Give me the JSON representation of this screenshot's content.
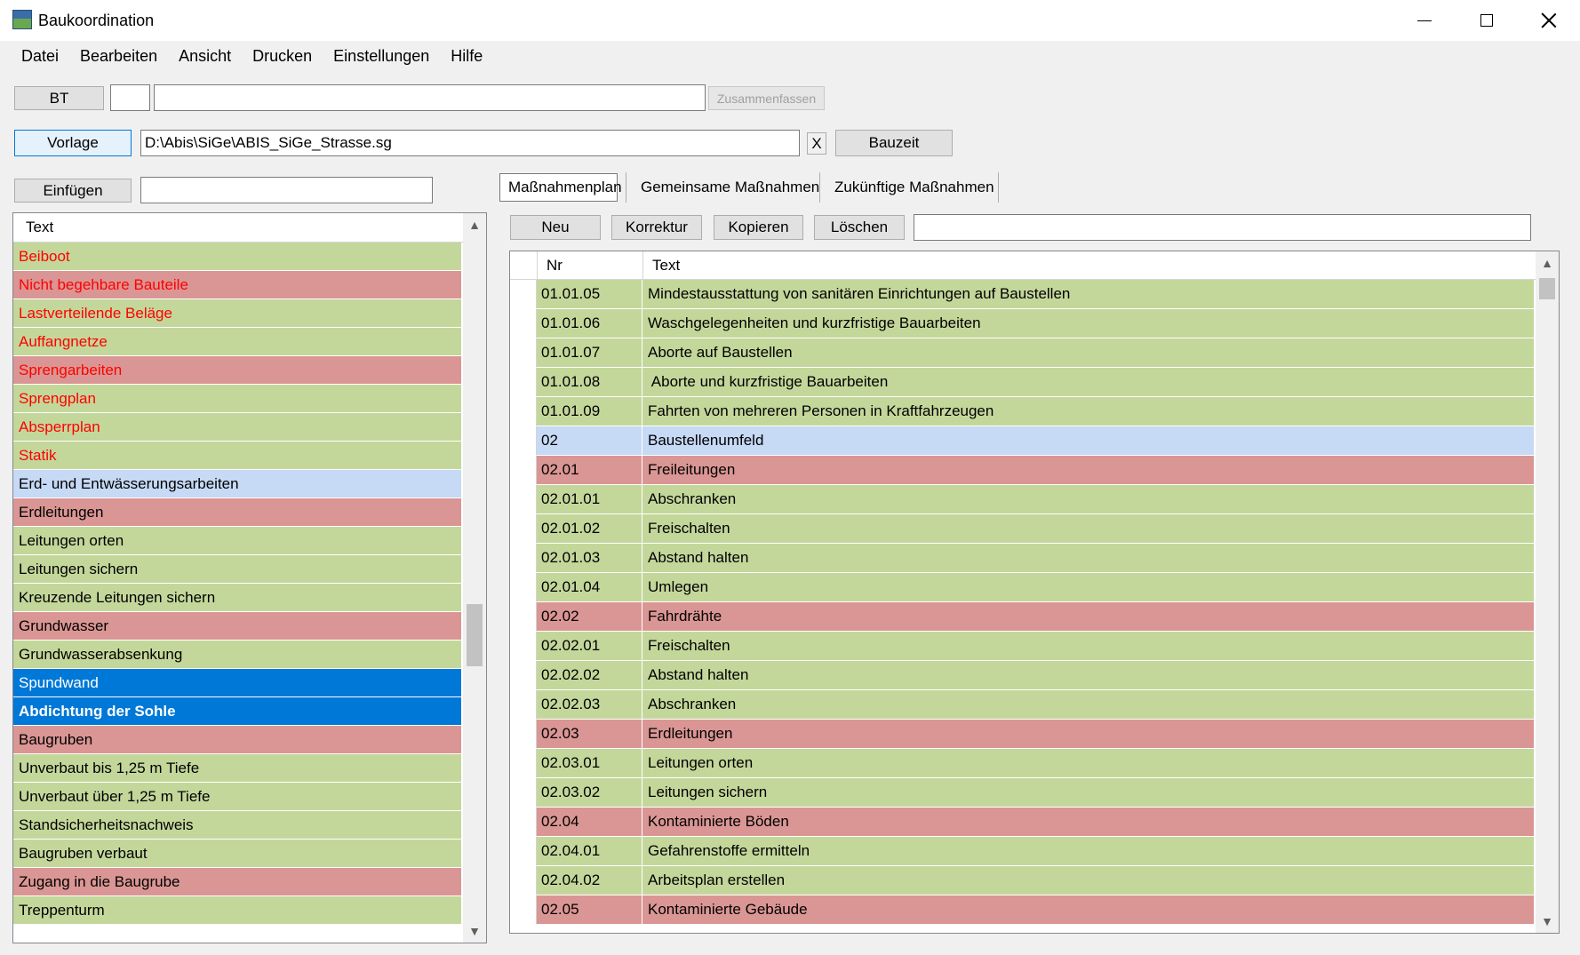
{
  "window": {
    "title": "Baukoordination"
  },
  "menu": [
    "Datei",
    "Bearbeiten",
    "Ansicht",
    "Drucken",
    "Einstellungen",
    "Hilfe"
  ],
  "row1": {
    "bt_label": "BT",
    "small_value": "",
    "wide_value": "",
    "summarize_label": "Zusammenfassen"
  },
  "row2": {
    "vorlage_label": "Vorlage",
    "path_value": "D:\\Abis\\SiGe\\ABIS_SiGe_Strasse.sg",
    "clear_label": "X",
    "bauzeit_label": "Bauzeit"
  },
  "row3": {
    "insert_label": "Einfügen",
    "insert_value": ""
  },
  "tabs": [
    "Maßnahmenplan",
    "Gemeinsame Maßnahmen",
    "Zukünftige Maßnahmen"
  ],
  "actions": {
    "new": "Neu",
    "correct": "Korrektur",
    "copy": "Kopieren",
    "delete": "Löschen",
    "search_value": ""
  },
  "colors": {
    "green": "#c4d79b",
    "red": "#da9694",
    "lightblue": "#c6d9f5",
    "selected": "#0078d7",
    "red_text": "#ff0000"
  },
  "left_list": {
    "header": "Text",
    "rows": [
      {
        "text": "Beiboot",
        "bg": "green",
        "fg": "red"
      },
      {
        "text": "Nicht begehbare Bauteile",
        "bg": "red",
        "fg": "red"
      },
      {
        "text": "Lastverteilende Beläge",
        "bg": "green",
        "fg": "red"
      },
      {
        "text": "Auffangnetze",
        "bg": "green",
        "fg": "red"
      },
      {
        "text": "Sprengarbeiten",
        "bg": "red",
        "fg": "red"
      },
      {
        "text": "Sprengplan",
        "bg": "green",
        "fg": "red"
      },
      {
        "text": "Absperrplan",
        "bg": "green",
        "fg": "red"
      },
      {
        "text": "Statik",
        "bg": "green",
        "fg": "red"
      },
      {
        "text": "Erd- und Entwässerungsarbeiten",
        "bg": "lightblue",
        "fg": "black"
      },
      {
        "text": "Erdleitungen",
        "bg": "red",
        "fg": "black"
      },
      {
        "text": "Leitungen orten",
        "bg": "green",
        "fg": "black"
      },
      {
        "text": "Leitungen sichern",
        "bg": "green",
        "fg": "black"
      },
      {
        "text": "Kreuzende Leitungen sichern",
        "bg": "green",
        "fg": "black"
      },
      {
        "text": "Grundwasser",
        "bg": "red",
        "fg": "black"
      },
      {
        "text": "Grundwasserabsenkung",
        "bg": "green",
        "fg": "black"
      },
      {
        "text": "Spundwand",
        "bg": "selected",
        "fg": "white"
      },
      {
        "text": "Abdichtung der Sohle",
        "bg": "selected",
        "fg": "white",
        "bold": true
      },
      {
        "text": "Baugruben",
        "bg": "red",
        "fg": "black"
      },
      {
        "text": "Unverbaut bis 1,25 m Tiefe",
        "bg": "green",
        "fg": "black"
      },
      {
        "text": "Unverbaut über 1,25 m Tiefe",
        "bg": "green",
        "fg": "black"
      },
      {
        "text": "Standsicherheitsnachweis",
        "bg": "green",
        "fg": "black"
      },
      {
        "text": "Baugruben verbaut",
        "bg": "green",
        "fg": "black"
      },
      {
        "text": "Zugang in die Baugrube",
        "bg": "red",
        "fg": "black"
      },
      {
        "text": "Treppenturm",
        "bg": "green",
        "fg": "black"
      }
    ]
  },
  "grid": {
    "header_nr": "Nr",
    "header_text": "Text",
    "rows": [
      {
        "nr": "01.01.05",
        "text": "Mindestausstattung von sanitären Einrichtungen auf Baustellen",
        "bg": "green"
      },
      {
        "nr": "01.01.06",
        "text": "Waschgelegenheiten und kurzfristige Bauarbeiten",
        "bg": "green"
      },
      {
        "nr": "01.01.07",
        "text": "Aborte auf Baustellen",
        "bg": "green"
      },
      {
        "nr": "01.01.08",
        "text": " Aborte und kurzfristige Bauarbeiten",
        "bg": "green"
      },
      {
        "nr": "01.01.09",
        "text": "Fahrten von mehreren Personen in Kraftfahrzeugen",
        "bg": "green"
      },
      {
        "nr": "02",
        "text": "Baustellenumfeld",
        "bg": "lightblue"
      },
      {
        "nr": "02.01",
        "text": "Freileitungen",
        "bg": "red"
      },
      {
        "nr": "02.01.01",
        "text": "Abschranken",
        "bg": "green"
      },
      {
        "nr": "02.01.02",
        "text": "Freischalten",
        "bg": "green"
      },
      {
        "nr": "02.01.03",
        "text": "Abstand halten",
        "bg": "green"
      },
      {
        "nr": "02.01.04",
        "text": "Umlegen",
        "bg": "green"
      },
      {
        "nr": "02.02",
        "text": "Fahrdrähte",
        "bg": "red"
      },
      {
        "nr": "02.02.01",
        "text": "Freischalten",
        "bg": "green"
      },
      {
        "nr": "02.02.02",
        "text": "Abstand halten",
        "bg": "green"
      },
      {
        "nr": "02.02.03",
        "text": "Abschranken",
        "bg": "green"
      },
      {
        "nr": "02.03",
        "text": "Erdleitungen",
        "bg": "red"
      },
      {
        "nr": "02.03.01",
        "text": "Leitungen orten",
        "bg": "green"
      },
      {
        "nr": "02.03.02",
        "text": "Leitungen sichern",
        "bg": "green"
      },
      {
        "nr": "02.04",
        "text": "Kontaminierte Böden",
        "bg": "red"
      },
      {
        "nr": "02.04.01",
        "text": "Gefahrenstoffe ermitteln",
        "bg": "green"
      },
      {
        "nr": "02.04.02",
        "text": "Arbeitsplan erstellen",
        "bg": "green"
      },
      {
        "nr": "02.05",
        "text": "Kontaminierte Gebäude",
        "bg": "red"
      }
    ]
  }
}
